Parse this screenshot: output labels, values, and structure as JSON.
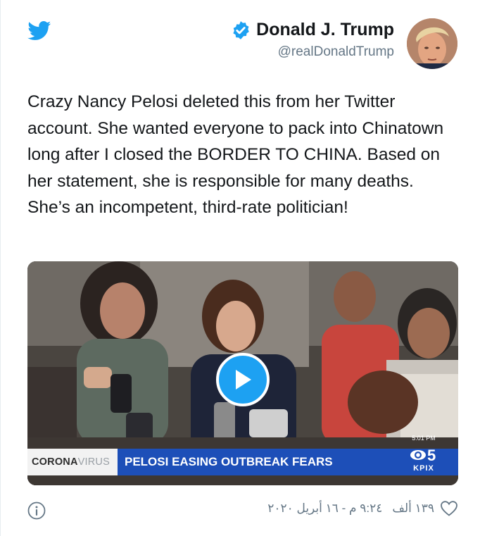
{
  "tweet": {
    "display_name": "Donald J. Trump",
    "handle": "@realDonaldTrump",
    "verified": true,
    "text": "Crazy Nancy Pelosi deleted this from her Twitter account. She wanted everyone to pack into Chinatown long after I closed the BORDER TO CHINA. Based on her statement, she is responsible for many deaths. She’s an incompetent, third-rate politician!",
    "accent_color": "#1da1f2",
    "icons": {
      "brand": "twitter-bird-icon",
      "verified": "verified-badge-icon",
      "play": "play-icon",
      "info": "info-icon",
      "like": "heart-icon"
    }
  },
  "media": {
    "brand_part_a": "CORONA",
    "brand_part_b": "VIRUS",
    "headline": "PELOSI EASING OUTBREAK FEARS",
    "station_time": "5:01 PM",
    "station_channel": "5",
    "station_call": "KPIX"
  },
  "footer": {
    "likes": "١٣٩ ألف",
    "timestamp": "٩:٢٤ م - ١٦ أبريل ٢٠٢٠"
  }
}
